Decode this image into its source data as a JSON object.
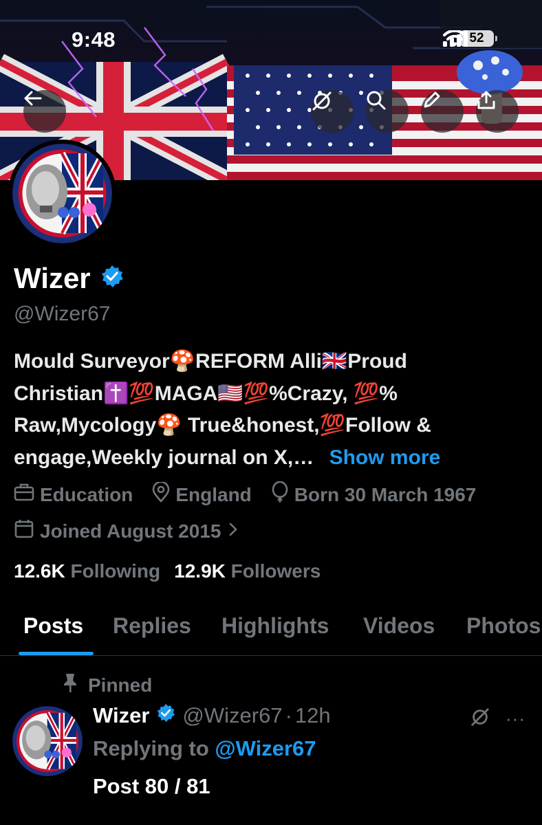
{
  "status_bar": {
    "time": "9:48",
    "battery": "52"
  },
  "banner": {
    "icons": [
      "back-arrow-icon",
      "grok-icon",
      "search-icon",
      "edit-icon",
      "share-icon"
    ]
  },
  "profile": {
    "name": "Wizer",
    "handle": "@Wizer67",
    "bio_lines": [
      "Mould Surveyor🍄REFORM Alli🇬🇧Proud",
      "Christian✝️💯MAGA🇺🇸💯%Crazy, 💯%",
      "Raw,Mycology🍄 True&honest,💯Follow &",
      "engage,Weekly journal on X,…"
    ],
    "show_more": "Show more",
    "category": "Education",
    "location": "England",
    "born": "Born 30 March 1967",
    "joined": "Joined August 2015",
    "following_count": "12.6K",
    "following_label": "Following",
    "followers_count": "12.9K",
    "followers_label": "Followers"
  },
  "tabs": [
    "Posts",
    "Replies",
    "Highlights",
    "Videos",
    "Photos"
  ],
  "post": {
    "pinned_label": "Pinned",
    "author_name": "Wizer",
    "author_handle": "@Wizer67",
    "separator": "·",
    "time": "12h",
    "replying_prefix": "Replying to",
    "replying_handle": "@Wizer67",
    "text": "Post 80 / 81",
    "more": "···"
  },
  "colors": {
    "accent": "#1d9bf0",
    "muted": "#71767b",
    "background": "#000000"
  }
}
